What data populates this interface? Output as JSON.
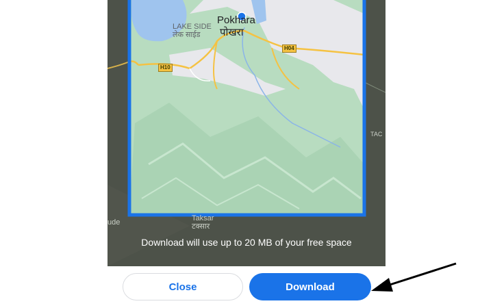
{
  "map": {
    "labels": {
      "city_en": "Pokhara",
      "city_ne": "पोखरा",
      "lakeside_en": "LAKE SIDE",
      "lakeside_ne": "लेक साईड",
      "highway_h04": "H04",
      "highway_h10": "H10",
      "village_en": "Taksar",
      "village_ne": "टक्सार",
      "edge_left": "ude",
      "edge_right": "TAC"
    },
    "colors": {
      "forest": "#b8dcc0",
      "urban": "#e8e8ec",
      "water": "#9fc4ee",
      "road": "#f5c242",
      "frame": "#1a73e8",
      "overlay": "#4d5249"
    },
    "icons": [
      "location-dot-icon"
    ]
  },
  "notice": "Download will use up to 20 MB of your free space",
  "buttons": {
    "close": "Close",
    "download": "Download"
  },
  "annotation": {
    "icon": "arrow-pointer-icon"
  }
}
